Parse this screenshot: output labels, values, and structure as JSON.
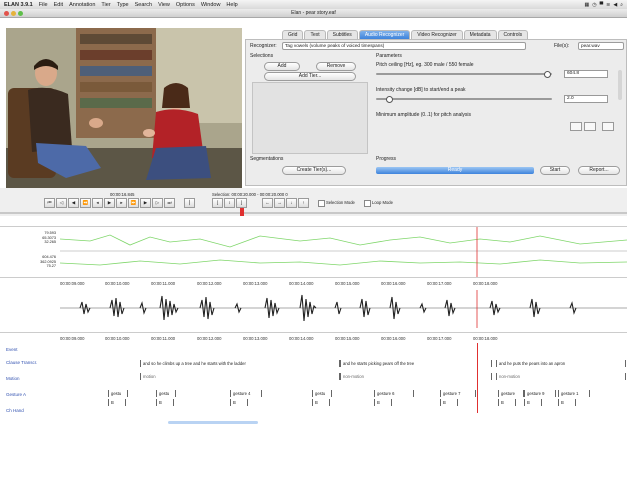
{
  "menubar": {
    "app": "ELAN 3.9.1",
    "items": [
      "File",
      "Edit",
      "Annotation",
      "Tier",
      "Type",
      "Search",
      "View",
      "Options",
      "Window",
      "Help"
    ]
  },
  "window": {
    "title": "Elan - pear story.eaf"
  },
  "tabs": [
    "Grid",
    "Text",
    "Subtitles",
    "Audio Recognizer",
    "Video Recognizer",
    "Metadata",
    "Controls"
  ],
  "active_tab": "Audio Recognizer",
  "recognizer": {
    "label": "Recognizer:",
    "selected": "Tag vowels (volume peaks of voiced timespans)",
    "files_label": "File(s):",
    "files_selected": "pear.wav"
  },
  "selections": {
    "title": "Selections",
    "add": "Add",
    "remove": "Remove",
    "add_tier": "Add Tier..."
  },
  "parameters": {
    "title": "Parameters",
    "p1_label": "Pitch ceiling [Hz], eg. 300 male / 550 female",
    "p1_value": "604.8",
    "p2_label": "Intensity change [dB] to start/end a peak",
    "p2_value": "2.0",
    "p3_label": "Minimum amplitude (0..1) for pitch analysis"
  },
  "segmentations": {
    "title": "Segmentations",
    "create": "Create Tier(s)..."
  },
  "progress": {
    "title": "Progress",
    "status": "Ready",
    "start": "Start",
    "report": "Report..."
  },
  "player": {
    "time": "00:00:16.845",
    "selection": "Selection: 00:00:20.000 - 00:00:20.000 0",
    "selection_mode": "Selection Mode",
    "loop_mode": "Loop Mode"
  },
  "pitch": {
    "values_a": [
      "79.593",
      "65.3073",
      "32.265"
    ],
    "values_b": [
      "604.476",
      "362.0925",
      "75.27"
    ]
  },
  "ruler_ticks": [
    "00:00:09.000",
    "00:00:10.000",
    "00:00:11.000",
    "00:00:12.000",
    "00:00:13.000",
    "00:00:14.000",
    "00:00:15.000",
    "00:00:16.000",
    "00:00:17.000",
    "00:00:18.000"
  ],
  "tiers": {
    "event": "Event",
    "clause": "Clause Transcr.",
    "motion": "Motion",
    "gesture": "Gesture A",
    "shape": "Ch Hand"
  },
  "annotations": {
    "clause_1": "and so he climbs up a tree and he starts with the ladder",
    "clause_2": "and he starts picking pears off the tree",
    "clause_3": "and he puts the pears into an apron",
    "motion_1": "motion",
    "motion_2": "non-motion",
    "motion_3": "non-motion",
    "gesture": [
      "gestu",
      "gestu",
      "gesture 4",
      "gestu",
      "gesture 6",
      "gesture 7",
      "gesture",
      "gesture 9",
      "gesture 1"
    ],
    "shape_letter": "B"
  },
  "colors": {
    "accent": "#3d83dc",
    "pitch": "#7fd66a",
    "cursor": "#e03030"
  }
}
